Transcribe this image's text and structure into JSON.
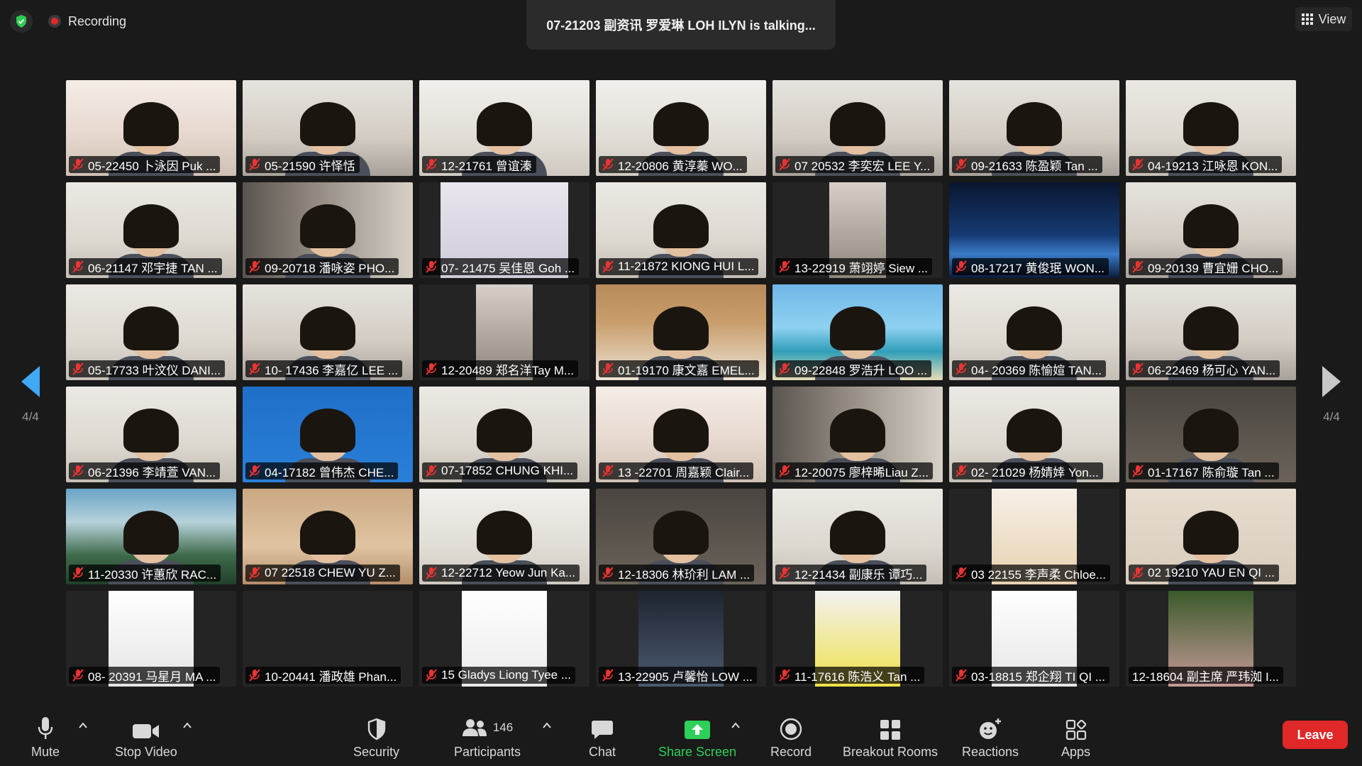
{
  "top": {
    "recording_label": "Recording",
    "talking_banner": "07-21203 副资讯 罗爱琳 LOH ILYN is talking...",
    "view_label": "View"
  },
  "nav": {
    "left_page": "4/4",
    "right_page": "4/4"
  },
  "tiles": [
    {
      "name": "05-22450 卜泳因 Puk ...",
      "scene": "window",
      "muted": true
    },
    {
      "name": "05-21590 许怿恬",
      "scene": "room",
      "muted": true
    },
    {
      "name": "12-21761 曾谊溱",
      "scene": "ceiling",
      "muted": true
    },
    {
      "name": "12-20806 黄淳蓁 WO...",
      "scene": "ceiling",
      "muted": true
    },
    {
      "name": "07 20532 李奕宏 LEE Y...",
      "scene": "room",
      "muted": true
    },
    {
      "name": "09-21633 陈盈颖 Tan ...",
      "scene": "room",
      "muted": true
    },
    {
      "name": "04-19213 江咏恩 KON...",
      "scene": "wall",
      "muted": true
    },
    {
      "name": "06-21147 邓宇捷 TAN ...",
      "scene": "wall",
      "muted": true
    },
    {
      "name": "09-20718 潘咏姿 PHO...",
      "scene": "shelf",
      "muted": true
    },
    {
      "name": "07- 21475 吴佳恩 Goh ...",
      "scene": "inset-mist",
      "muted": true
    },
    {
      "name": "11-21872 KIONG HUI L...",
      "scene": "wall",
      "muted": true
    },
    {
      "name": "13-22919 萧翊婷 Siew ...",
      "scene": "inset-dark",
      "muted": true
    },
    {
      "name": "08-17217 黄俊珉 WON...",
      "scene": "space",
      "muted": true
    },
    {
      "name": "09-20139 曹宜姗 CHO...",
      "scene": "room",
      "muted": true
    },
    {
      "name": "05-17733 叶汶仪 DANI...",
      "scene": "wall",
      "muted": true
    },
    {
      "name": "10- 17436 李嘉亿 LEE ...",
      "scene": "room",
      "muted": true
    },
    {
      "name": "12-20489 郑名洋Tay M...",
      "scene": "inset-dark",
      "muted": true
    },
    {
      "name": "01-19170 康文嘉 EMEL...",
      "scene": "kitchen",
      "muted": true
    },
    {
      "name": "09-22848 罗浩升 LOO ...",
      "scene": "beach",
      "muted": true
    },
    {
      "name": "04- 20369 陈愉媗 TAN...",
      "scene": "wall",
      "muted": true
    },
    {
      "name": "06-22469 杨可心 YAN...",
      "scene": "room",
      "muted": true
    },
    {
      "name": "06-21396 李靖萱 VAN...",
      "scene": "wall",
      "muted": true
    },
    {
      "name": "04-17182 曾伟杰 CHE...",
      "scene": "blue",
      "muted": true
    },
    {
      "name": "07-17852 CHUNG KHI...",
      "scene": "wall",
      "muted": true
    },
    {
      "name": "13 -22701 周嘉颖 Clair...",
      "scene": "window",
      "muted": true
    },
    {
      "name": "12-20075 廖梓晞Liau Z...",
      "scene": "shelf",
      "muted": true
    },
    {
      "name": "02- 21029 杨婧婞 Yon...",
      "scene": "wall",
      "muted": true
    },
    {
      "name": "01-17167 陈俞璇 Tan ...",
      "scene": "dim",
      "muted": true
    },
    {
      "name": "11-20330 许蕙欣 RAC...",
      "scene": "mountain",
      "muted": true
    },
    {
      "name": "07 22518  CHEW YU Z...",
      "scene": "warm",
      "muted": true
    },
    {
      "name": "12-22712 Yeow Jun Ka...",
      "scene": "ceiling",
      "muted": true
    },
    {
      "name": "12-18306 林玠利 LAM ...",
      "scene": "dim",
      "muted": true
    },
    {
      "name": "12-21434 副康乐 谭巧...",
      "scene": "wall",
      "muted": true
    },
    {
      "name": "03 22155 李声柔 Chloe...",
      "scene": "inset-cartoon",
      "muted": true
    },
    {
      "name": "02 19210 YAU EN QI ...",
      "scene": "beige",
      "muted": true
    },
    {
      "name": "08- 20391 马星月 MA ...",
      "scene": "inset-anime",
      "muted": true
    },
    {
      "name": "10-20441 潘政雄 Phan...",
      "scene": "black",
      "muted": true
    },
    {
      "name": "15 Gladys Liong Tyee ...",
      "scene": "inset-witch",
      "muted": true
    },
    {
      "name": "13-22905 卢馨怡 LOW ...",
      "scene": "inset-anime2",
      "muted": true
    },
    {
      "name": "11-17616 陈浩义 Tan ...",
      "scene": "inset-sponge",
      "muted": true
    },
    {
      "name": "03-18815 郑企翔 TI QI ...",
      "scene": "inset-sketch",
      "muted": true
    },
    {
      "name": "12-18604 副主席 严玮洳 I...",
      "scene": "inset-flowers",
      "muted": false
    }
  ],
  "toolbar": {
    "mute": "Mute",
    "stop_video": "Stop Video",
    "security": "Security",
    "participants": "Participants",
    "participants_count": "146",
    "chat": "Chat",
    "share_screen": "Share Screen",
    "record": "Record",
    "breakout_rooms": "Breakout Rooms",
    "reactions": "Reactions",
    "apps": "Apps",
    "leave": "Leave"
  },
  "colors": {
    "background": "#1a1a1a",
    "accent_blue": "#3fa9f5",
    "share_green": "#2ed05a",
    "leave_red": "#e02828",
    "shield_green": "#2ecc52"
  }
}
